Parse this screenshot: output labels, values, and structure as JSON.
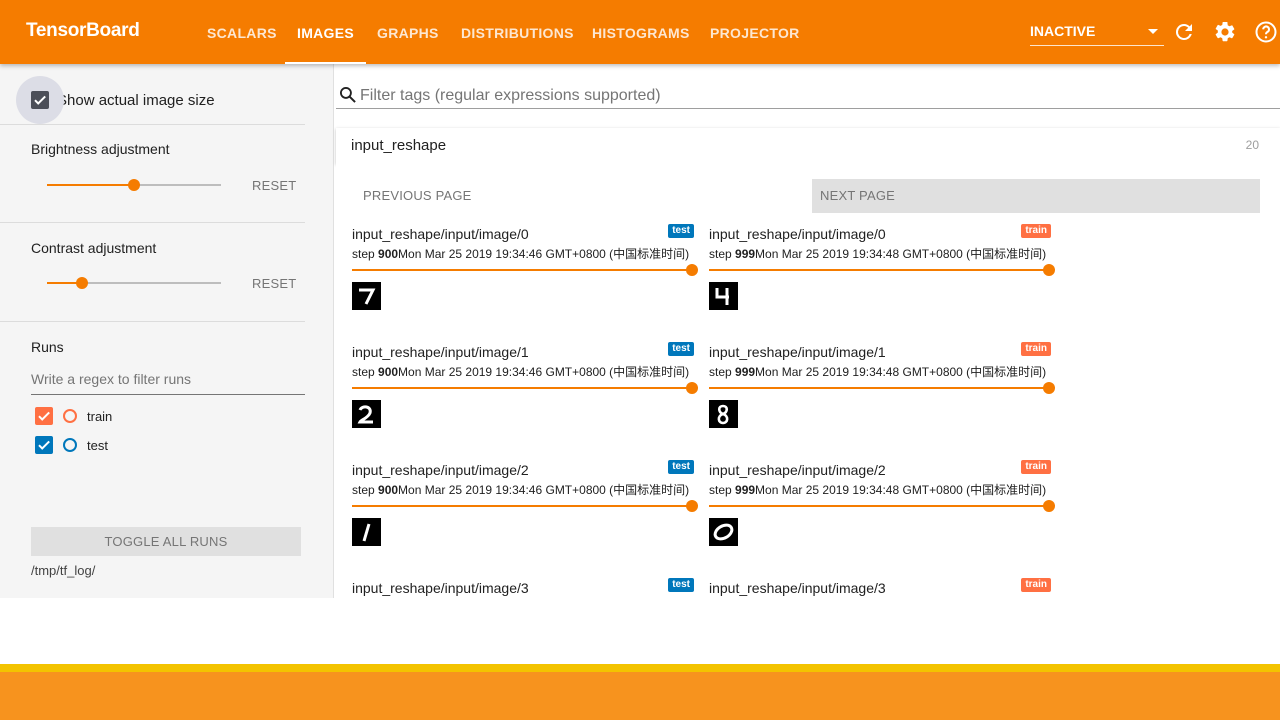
{
  "app": {
    "brand": "TensorBoard",
    "accent": "#f57c00"
  },
  "nav": {
    "tabs": [
      {
        "label": "SCALARS",
        "active": false
      },
      {
        "label": "IMAGES",
        "active": true
      },
      {
        "label": "GRAPHS",
        "active": false
      },
      {
        "label": "DISTRIBUTIONS",
        "active": false
      },
      {
        "label": "HISTOGRAMS",
        "active": false
      },
      {
        "label": "PROJECTOR",
        "active": false
      }
    ],
    "run_state": "INACTIVE",
    "icons": [
      "refresh-icon",
      "settings-gear-icon",
      "help-icon"
    ]
  },
  "sidebar": {
    "actual_size": {
      "label": "Show actual image size",
      "checked": true
    },
    "brightness": {
      "title": "Brightness adjustment",
      "value": 0.5,
      "reset": "RESET"
    },
    "contrast": {
      "title": "Contrast adjustment",
      "value": 0.2,
      "reset": "RESET"
    },
    "runs": {
      "title": "Runs",
      "filter_placeholder": "Write a regex to filter runs",
      "items": [
        {
          "name": "train",
          "checked": true,
          "color": "#ff7043"
        },
        {
          "name": "test",
          "checked": true,
          "color": "#0077bb"
        }
      ],
      "toggle_all": "TOGGLE ALL RUNS",
      "logdir": "/tmp/tf_log/"
    }
  },
  "main": {
    "filter_placeholder": "Filter tags (regular expressions supported)",
    "card": {
      "title": "input_reshape",
      "count": "20",
      "prev": "PREVIOUS PAGE",
      "next": "NEXT PAGE",
      "images": [
        {
          "tag": "input_reshape/input/image/0",
          "run": "test",
          "step": "900",
          "time": "Mon Mar 25 2019 19:34:46 GMT+0800 (中国标准时间)",
          "digit": "7"
        },
        {
          "tag": "input_reshape/input/image/0",
          "run": "train",
          "step": "999",
          "time": "Mon Mar 25 2019 19:34:48 GMT+0800 (中国标准时间)",
          "digit": "4"
        },
        {
          "tag": "input_reshape/input/image/1",
          "run": "test",
          "step": "900",
          "time": "Mon Mar 25 2019 19:34:46 GMT+0800 (中国标准时间)",
          "digit": "2"
        },
        {
          "tag": "input_reshape/input/image/1",
          "run": "train",
          "step": "999",
          "time": "Mon Mar 25 2019 19:34:48 GMT+0800 (中国标准时间)",
          "digit": "8"
        },
        {
          "tag": "input_reshape/input/image/2",
          "run": "test",
          "step": "900",
          "time": "Mon Mar 25 2019 19:34:46 GMT+0800 (中国标准时间)",
          "digit": "1"
        },
        {
          "tag": "input_reshape/input/image/2",
          "run": "train",
          "step": "999",
          "time": "Mon Mar 25 2019 19:34:48 GMT+0800 (中国标准时间)",
          "digit": "0"
        },
        {
          "tag": "input_reshape/input/image/3",
          "run": "test",
          "step": "900",
          "time": "Mon Mar 25 2019 19:34:46 GMT+0800 (中国标准时间)",
          "digit": ""
        },
        {
          "tag": "input_reshape/input/image/3",
          "run": "train",
          "step": "999",
          "time": "Mon Mar 25 2019 19:34:48 GMT+0800 (中国标准时间)",
          "digit": ""
        }
      ],
      "step_label": "step "
    }
  },
  "colors": {
    "test_badge": "#0077bb",
    "train_badge": "#ff7043"
  }
}
